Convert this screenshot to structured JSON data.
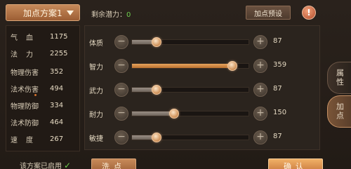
{
  "left_panel": {
    "plan_button": "加点方案1",
    "stats": [
      {
        "label": "气血",
        "value": "1175",
        "spaced": true
      },
      {
        "label": "法力",
        "value": "2255",
        "spaced": true
      },
      {
        "label": "物理伤害",
        "value": "352",
        "spaced": false
      },
      {
        "label": "法术伤害",
        "value": "494",
        "spaced": false
      },
      {
        "label": "物理防御",
        "value": "334",
        "spaced": false
      },
      {
        "label": "法术防御",
        "value": "464",
        "spaced": false
      },
      {
        "label": "速度",
        "value": "267",
        "spaced": true
      }
    ],
    "footer": "该方案已启用"
  },
  "header": {
    "potential_label": "剩余潜力：",
    "potential_value": "0",
    "preset_button": "加点预设",
    "info_icon": "!"
  },
  "attributes": [
    {
      "label": "体质",
      "value": "87",
      "level": 0.21,
      "highlight": false
    },
    {
      "label": "智力",
      "value": "359",
      "level": 0.86,
      "highlight": true
    },
    {
      "label": "武力",
      "value": "87",
      "level": 0.21,
      "highlight": false
    },
    {
      "label": "耐力",
      "value": "150",
      "level": 0.36,
      "highlight": false
    },
    {
      "label": "敏捷",
      "value": "87",
      "level": 0.21,
      "highlight": false
    }
  ],
  "buttons": {
    "minus": "−",
    "plus": "+",
    "wash": "洗点",
    "confirm": "确认"
  },
  "tabs": [
    {
      "label": "属性",
      "active": false
    },
    {
      "label": "加点",
      "active": true
    }
  ],
  "colors": {
    "accent": "#c78a5a",
    "highlight_fill": "#e7a45e",
    "potential_green": "#6fcf4e"
  }
}
